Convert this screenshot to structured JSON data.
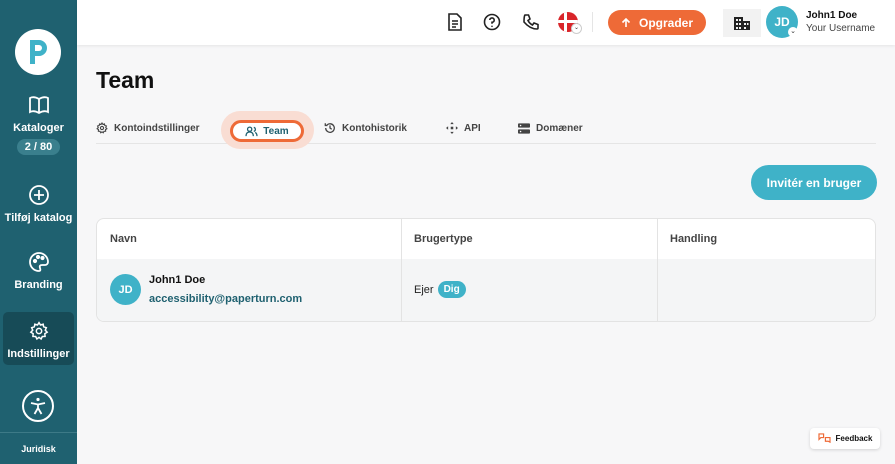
{
  "sidebar": {
    "items": [
      {
        "label": "Kataloger",
        "counter": "2 / 80",
        "icon": "book-icon"
      },
      {
        "label": "Tilføj katalog",
        "icon": "plus-circle-icon"
      },
      {
        "label": "Branding",
        "icon": "palette-icon"
      },
      {
        "label": "Indstillinger",
        "icon": "gear-icon",
        "active": true
      }
    ],
    "footer_label": "Juridisk"
  },
  "header": {
    "upgrade_label": "Opgrader",
    "user_initials": "JD",
    "user_name": "John1 Doe",
    "user_subtitle": "Your Username"
  },
  "page": {
    "title": "Team",
    "tabs": [
      {
        "label": "Kontoindstillinger"
      },
      {
        "label": "Team",
        "active": true
      },
      {
        "label": "Kontohistorik"
      },
      {
        "label": "API"
      },
      {
        "label": "Domæner"
      }
    ],
    "invite_label": "Invitér en bruger"
  },
  "table": {
    "columns": [
      "Navn",
      "Brugertype",
      "Handling"
    ],
    "rows": [
      {
        "initials": "JD",
        "name": "John1 Doe",
        "email": "accessibility@paperturn.com",
        "type": "Ejer",
        "badge": "Dig"
      }
    ]
  },
  "feedback_label": "Feedback",
  "colors": {
    "sidebar": "#1f6170",
    "accent": "#ee6a37",
    "teal": "#3fb2c8"
  }
}
